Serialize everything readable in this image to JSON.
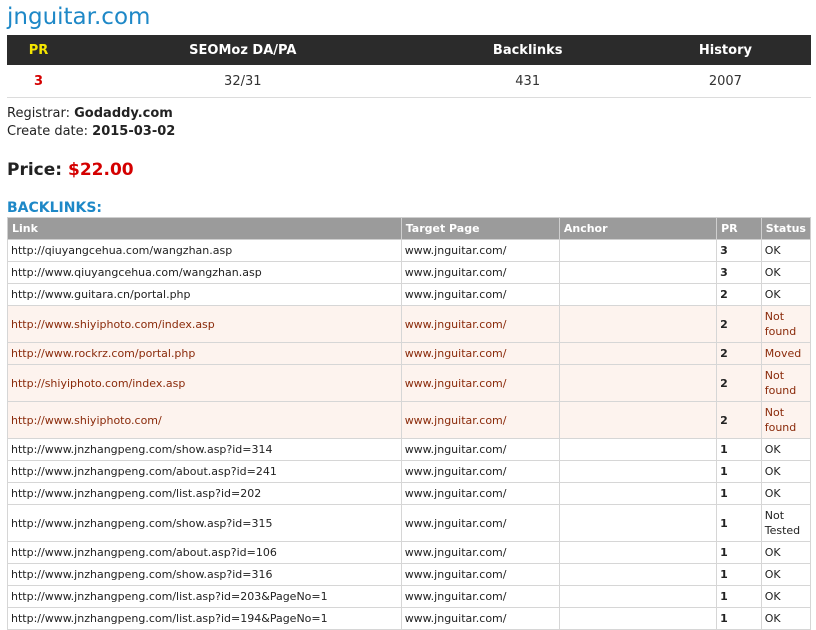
{
  "site": {
    "title": "jnguitar.com"
  },
  "summary": {
    "headers": {
      "pr": "PR",
      "seomoz": "SEOMoz DA/PA",
      "backlinks": "Backlinks",
      "history": "History"
    },
    "values": {
      "pr": "3",
      "seomoz": "32/31",
      "backlinks": "431",
      "history": "2007"
    }
  },
  "info": {
    "registrar_label": "Registrar:",
    "registrar": "Godaddy.com",
    "create_label": "Create date:",
    "create_date": "2015-03-02"
  },
  "price": {
    "label": "Price:",
    "value": "$22.00"
  },
  "backlinks": {
    "heading": "BACKLINKS:",
    "columns": [
      "Link",
      "Target Page",
      "Anchor",
      "PR",
      "Status"
    ],
    "rows": [
      {
        "link": "http://qiuyangcehua.com/wangzhan.asp",
        "target": "www.jnguitar.com/",
        "anchor": "",
        "pr": "3",
        "status": "OK"
      },
      {
        "link": "http://www.qiuyangcehua.com/wangzhan.asp",
        "target": "www.jnguitar.com/",
        "anchor": "",
        "pr": "3",
        "status": "OK"
      },
      {
        "link": "http://www.guitara.cn/portal.php",
        "target": "www.jnguitar.com/",
        "anchor": "",
        "pr": "2",
        "status": "OK"
      },
      {
        "link": "http://www.shiyiphoto.com/index.asp",
        "target": "www.jnguitar.com/",
        "anchor": "",
        "pr": "2",
        "status": "Not found"
      },
      {
        "link": "http://www.rockrz.com/portal.php",
        "target": "www.jnguitar.com/",
        "anchor": "",
        "pr": "2",
        "status": "Moved"
      },
      {
        "link": "http://shiyiphoto.com/index.asp",
        "target": "www.jnguitar.com/",
        "anchor": "",
        "pr": "2",
        "status": "Not found"
      },
      {
        "link": "http://www.shiyiphoto.com/",
        "target": "www.jnguitar.com/",
        "anchor": "",
        "pr": "2",
        "status": "Not found"
      },
      {
        "link": "http://www.jnzhangpeng.com/show.asp?id=314",
        "target": "www.jnguitar.com/",
        "anchor": "",
        "pr": "1",
        "status": "OK"
      },
      {
        "link": "http://www.jnzhangpeng.com/about.asp?id=241",
        "target": "www.jnguitar.com/",
        "anchor": "",
        "pr": "1",
        "status": "OK"
      },
      {
        "link": "http://www.jnzhangpeng.com/list.asp?id=202",
        "target": "www.jnguitar.com/",
        "anchor": "",
        "pr": "1",
        "status": "OK"
      },
      {
        "link": "http://www.jnzhangpeng.com/show.asp?id=315",
        "target": "www.jnguitar.com/",
        "anchor": "",
        "pr": "1",
        "status": "Not Tested"
      },
      {
        "link": "http://www.jnzhangpeng.com/about.asp?id=106",
        "target": "www.jnguitar.com/",
        "anchor": "",
        "pr": "1",
        "status": "OK"
      },
      {
        "link": "http://www.jnzhangpeng.com/show.asp?id=316",
        "target": "www.jnguitar.com/",
        "anchor": "",
        "pr": "1",
        "status": "OK"
      },
      {
        "link": "http://www.jnzhangpeng.com/list.asp?id=203&PageNo=1",
        "target": "www.jnguitar.com/",
        "anchor": "",
        "pr": "1",
        "status": "OK"
      },
      {
        "link": "http://www.jnzhangpeng.com/list.asp?id=194&PageNo=1",
        "target": "www.jnguitar.com/",
        "anchor": "",
        "pr": "1",
        "status": "OK"
      }
    ]
  }
}
